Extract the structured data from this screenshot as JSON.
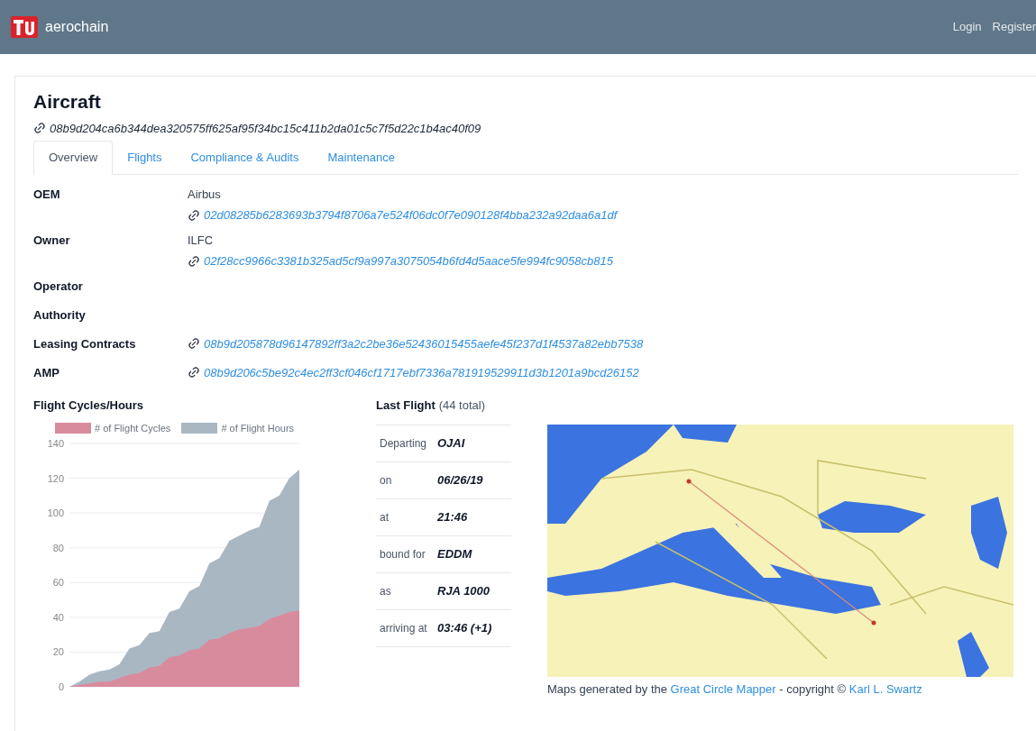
{
  "navbar": {
    "brand": "aerochain",
    "links": [
      "Login",
      "Register"
    ]
  },
  "page": {
    "title": "Aircraft",
    "hash": "08b9d204ca6b344dea320575ff625af95f34bc15c411b2da01c5c7f5d22c1b4ac40f09"
  },
  "tabs": [
    {
      "label": "Overview",
      "selected": true
    },
    {
      "label": "Flights",
      "selected": false
    },
    {
      "label": "Compliance & Audits",
      "selected": false
    },
    {
      "label": "Maintenance",
      "selected": false
    }
  ],
  "details": [
    {
      "label": "OEM",
      "value": "Airbus",
      "hash": "02d08285b6283693b3794f8706a7e524f06dc0f7e090128f4bba232a92daa6a1df"
    },
    {
      "label": "Owner",
      "value": "ILFC",
      "hash": "02f28cc9966c3381b325ad5cf9a997a3075054b6fd4d5aace5fe994fc9058cb815"
    },
    {
      "label": "Operator"
    },
    {
      "label": "Authority"
    },
    {
      "label": "Leasing Contracts",
      "hash": "08b9d205878d96147892ff3a2c2be36e52436015455aefe45f237d1f4537a82ebb7538"
    },
    {
      "label": "AMP",
      "hash": "08b9d206c5be92c4ec2ff3cf046cf1717ebf7336a781919529911d3b1201a9bcd26152"
    }
  ],
  "cycles_hours": {
    "title": "Flight Cycles/Hours",
    "chart_data": {
      "type": "area",
      "grid": true,
      "legend": true,
      "ylim": [
        0,
        140
      ],
      "yticks": [
        0,
        20,
        40,
        60,
        80,
        100,
        120,
        140
      ],
      "stacked": false,
      "series": [
        {
          "name": "# of Flight Cycles",
          "color": "#d98b9e",
          "values": [
            0,
            1,
            2,
            3,
            3,
            5,
            7,
            8,
            11,
            12,
            17,
            18,
            21,
            22,
            27,
            28,
            31,
            33,
            34,
            35,
            39,
            41,
            43,
            44
          ]
        },
        {
          "name": "# of Flight Hours",
          "color": "#a9b7c3",
          "values": [
            0,
            3,
            7,
            9,
            10,
            13,
            22,
            24,
            31,
            32,
            43,
            45,
            55,
            58,
            71,
            74,
            84,
            87,
            90,
            92,
            107,
            110,
            120,
            125
          ]
        }
      ]
    }
  },
  "last_flight": {
    "title": "Last Flight",
    "count": "(44 total)",
    "rows": [
      {
        "label": "Departing",
        "value": "OJAI"
      },
      {
        "label": "on",
        "value": "06/26/19"
      },
      {
        "label": "at",
        "value": "21:46"
      },
      {
        "label": "bound for",
        "value": "EDDM"
      },
      {
        "label": "as",
        "value": "RJA 1000"
      },
      {
        "label": "arriving at",
        "value": "03:46 (+1)"
      }
    ],
    "caption": [
      {
        "kind": "text",
        "text": "Maps generated by the "
      },
      {
        "kind": "link",
        "text": "Great Circle Mapper"
      },
      {
        "kind": "text",
        "text": " - copyright © "
      },
      {
        "kind": "link",
        "text": "Karl L. Swartz"
      }
    ]
  }
}
